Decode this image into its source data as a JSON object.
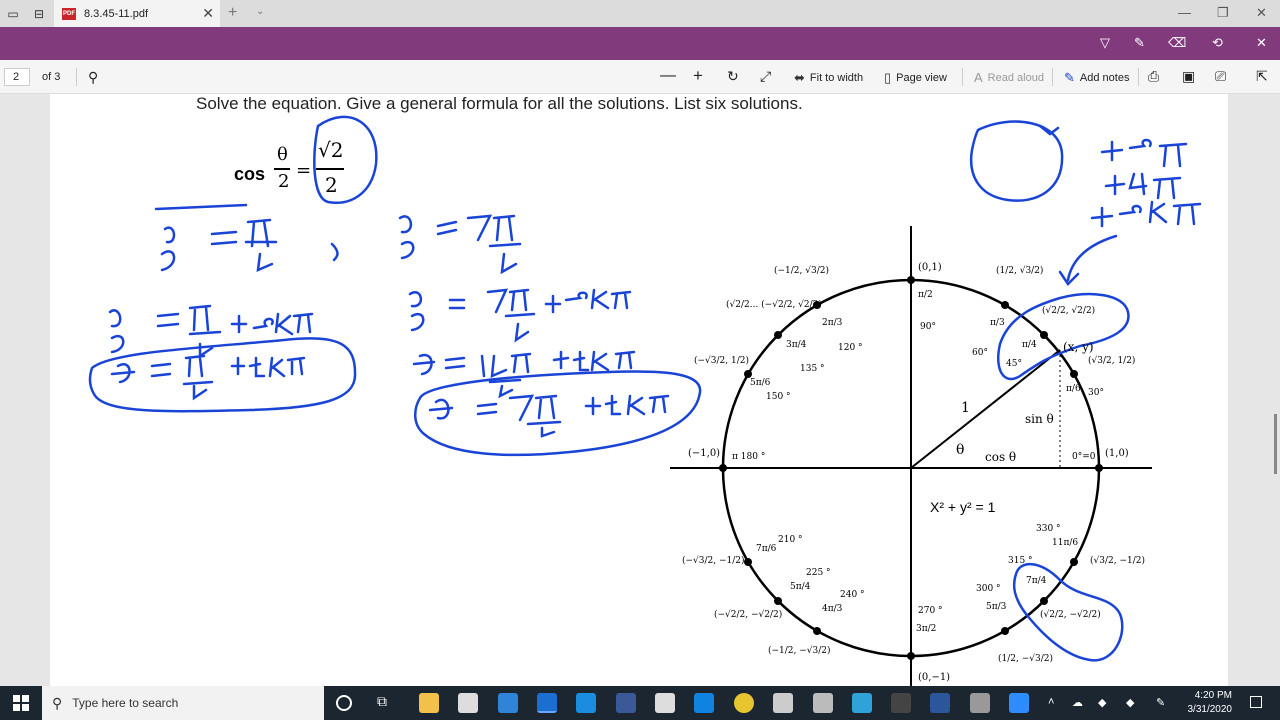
{
  "tabbar": {
    "tab_title": "8.3.45-11.pdf",
    "new_tab_glyph": "+",
    "close_glyph": "✕",
    "tab_menu_glyph": "⌄",
    "minimize_glyph": "—",
    "maximize_glyph": "❐",
    "window_close_glyph": "✕"
  },
  "toolbar": {
    "page_number": "2",
    "page_count": "of 3",
    "fit_to_width": "Fit to width",
    "page_view": "Page view",
    "read_aloud": "Read aloud",
    "add_notes": "Add notes"
  },
  "document": {
    "problem_text": "Solve the equation. Give a general formula for all the solutions. List six solutions.",
    "equation": {
      "func": "cos",
      "numerator": "θ",
      "denominator": "2",
      "equals": "=",
      "rhs_numerator": "√2",
      "rhs_denominator": "2"
    },
    "unit_circle": {
      "equation": "X² + y² = 1",
      "radius_label": "1",
      "angle_label": "θ",
      "cos_label": "cos θ",
      "sin_label": "sin θ",
      "point_label": "(x, y)",
      "axis_points": {
        "top": "(0,1)",
        "left": "(−1,0)",
        "right": "(1,0)",
        "bottom": "(0,−1)"
      },
      "degree_labels": [
        "90°",
        "60°",
        "45°",
        "30°",
        "0°=0",
        "120 °",
        "135 °",
        "150 °",
        "π  180 °",
        "210 °",
        "225 °",
        "240 °",
        "270 °",
        "300 °",
        "315 °",
        "330 °"
      ],
      "radian_labels": [
        "π/2",
        "π/3",
        "π/4",
        "π/6",
        "2π/3",
        "3π/4",
        "5π/6",
        "7π/6",
        "5π/4",
        "4π/3",
        "3π/2",
        "5π/3",
        "7π/4",
        "11π/6"
      ],
      "coord_labels": [
        "(−1/2, √3/2)",
        "(√2/2... (−√2/2, √2/2)",
        "(−√3/2, 1/2)",
        "(1/2, √3/2)",
        "(√2/2, √2/2)",
        "(√3/2, 1/2)",
        "(−√3/2, −1/2)",
        "(−√2/2, −√2/2)",
        "(−1/2, −√3/2)",
        "(√3/2, −1/2)",
        "(√2/2, −√2/2)",
        "(1/2, −√3/2)"
      ]
    }
  },
  "taskbar": {
    "search_placeholder": "Type here to search",
    "time": "4:20 PM",
    "date": "3/31/2020"
  },
  "colors": {
    "purple_bar": "#813a7c",
    "ink_blue": "#1a44d6",
    "taskbar": "#1c2631"
  }
}
